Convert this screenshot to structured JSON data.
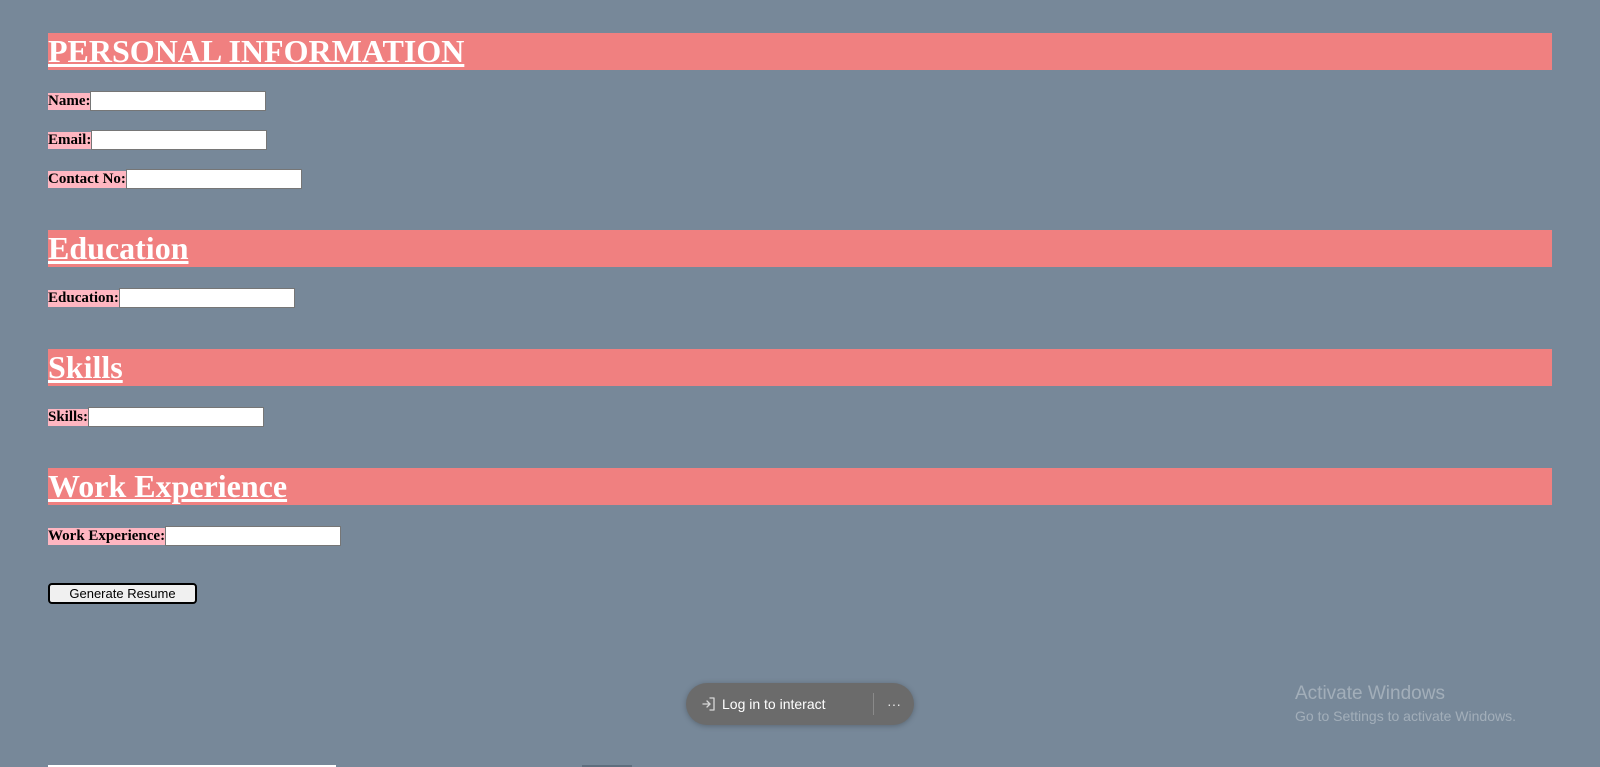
{
  "sections": {
    "personal": {
      "heading": "PERSONAL INFORMATION",
      "fields": {
        "name": {
          "label": "Name:",
          "value": ""
        },
        "email": {
          "label": "Email:",
          "value": ""
        },
        "contact": {
          "label": "Contact No:",
          "value": ""
        }
      }
    },
    "education": {
      "heading": "Education",
      "fields": {
        "education": {
          "label": "Education:",
          "value": ""
        }
      }
    },
    "skills": {
      "heading": "Skills",
      "fields": {
        "skills": {
          "label": "Skills:",
          "value": ""
        }
      }
    },
    "work": {
      "heading": "Work Experience",
      "fields": {
        "work": {
          "label": "Work Experience:",
          "value": ""
        }
      }
    }
  },
  "actions": {
    "generate_label": "Generate Resume"
  },
  "overlay": {
    "login_label": "Log in to interact",
    "login_icon": "sign-in-icon",
    "more_icon": "more-icon",
    "more_glyph": "···"
  },
  "watermark": {
    "title": "Activate Windows",
    "subtitle": "Go to Settings to activate Windows."
  },
  "colors": {
    "page_background": "#778899",
    "section_header_bg": "#f08080",
    "label_bg": "#ffb6c1"
  }
}
